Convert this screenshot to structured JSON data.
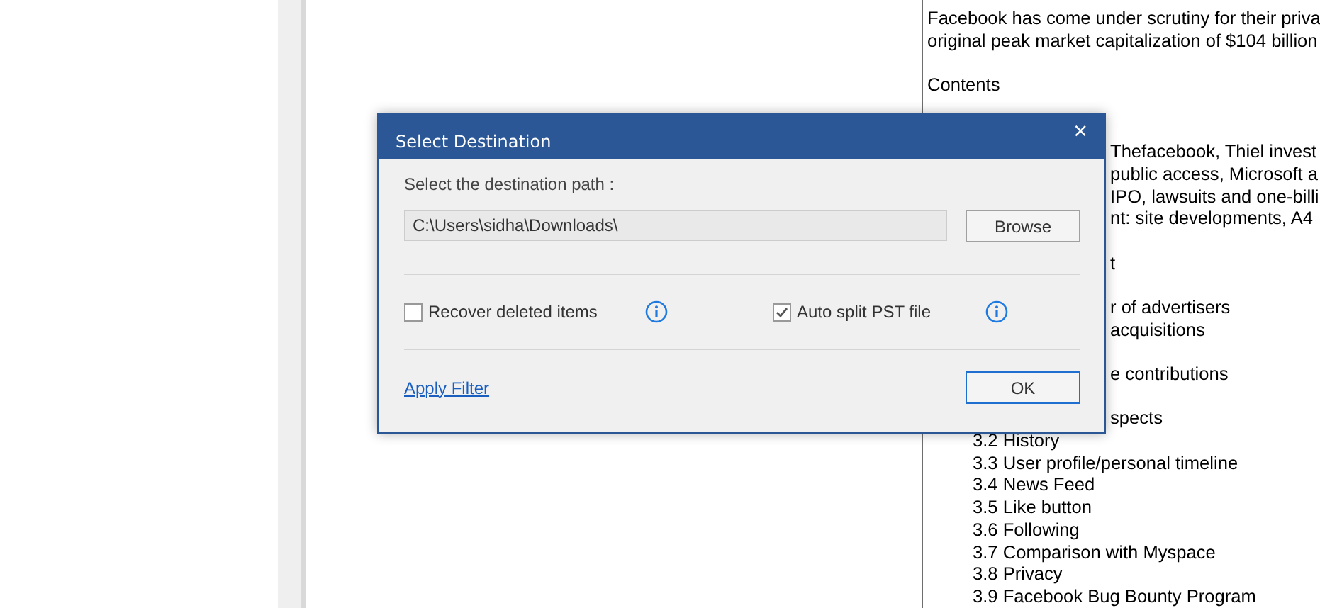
{
  "document": {
    "lines": [
      {
        "kind": "full",
        "text": "Facebook has come under scrutiny for their priva"
      },
      {
        "kind": "full",
        "text": "original peak market capitalization of $104 billion"
      },
      {
        "kind": "blank"
      },
      {
        "kind": "full",
        "text": "Contents"
      },
      {
        "kind": "blank"
      },
      {
        "kind": "blank"
      },
      {
        "kind": "tail",
        "text": "Thefacebook, Thiel invest"
      },
      {
        "kind": "tail",
        "text": "public access, Microsoft a"
      },
      {
        "kind": "tail",
        "text": "IPO, lawsuits and one-billi"
      },
      {
        "kind": "tail",
        "text": "nt: site developments, A4"
      },
      {
        "kind": "blank"
      },
      {
        "kind": "tail",
        "text": "t"
      },
      {
        "kind": "blank"
      },
      {
        "kind": "tail",
        "text": "r of advertisers"
      },
      {
        "kind": "tail",
        "text": "acquisitions"
      },
      {
        "kind": "blank"
      },
      {
        "kind": "tail",
        "text": "e contributions"
      },
      {
        "kind": "blank"
      },
      {
        "kind": "tail",
        "text": "spects"
      },
      {
        "kind": "item",
        "text": "3.2 History"
      },
      {
        "kind": "item",
        "text": "3.3 User profile/personal timeline"
      },
      {
        "kind": "item",
        "text": "3.4 News Feed"
      },
      {
        "kind": "item",
        "text": "3.5 Like button"
      },
      {
        "kind": "item",
        "text": "3.6 Following"
      },
      {
        "kind": "item",
        "text": "3.7 Comparison with Myspace"
      },
      {
        "kind": "item",
        "text": "3.8 Privacy"
      },
      {
        "kind": "item",
        "text": "3.9 Facebook Bug Bounty Program"
      }
    ]
  },
  "dialog": {
    "title": "Select Destination",
    "close": "×",
    "path_label": "Select the destination path :",
    "path_value": "C:\\Users\\sidha\\Downloads\\",
    "browse": "Browse",
    "options": [
      {
        "label": "Recover deleted items",
        "checked": false
      },
      {
        "label": "Auto split PST file",
        "checked": true
      }
    ],
    "link": "Apply Filter",
    "ok": "OK"
  }
}
